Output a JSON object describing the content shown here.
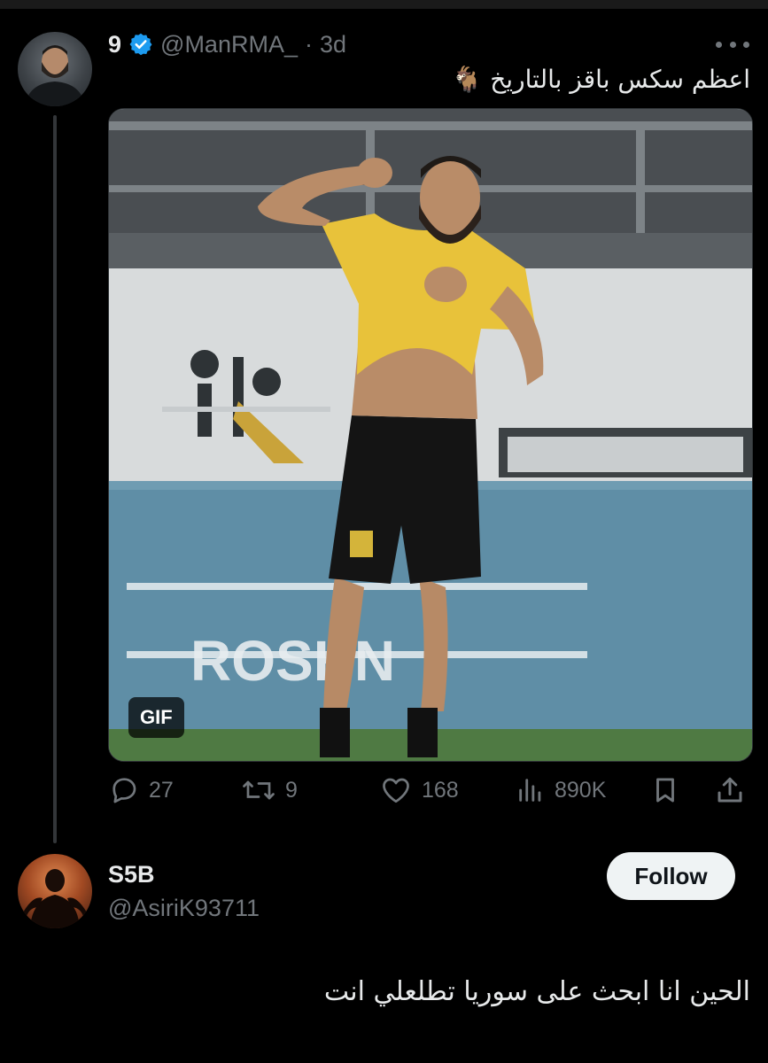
{
  "tweet": {
    "author_name": "9",
    "handle": "@ManRMA_",
    "separator": "·",
    "time": "3d",
    "text": "اعظم سكس باقز بالتاريخ 🐐",
    "media": {
      "badge": "GIF",
      "banner_text": "ROSHN"
    },
    "actions": {
      "replies": "27",
      "retweets": "9",
      "likes": "168",
      "views": "890K"
    },
    "icons": {
      "verified": "verified-badge-icon",
      "more": "more-options-icon",
      "reply": "reply-icon",
      "retweet": "retweet-icon",
      "like": "like-icon",
      "views": "views-icon",
      "bookmark": "bookmark-icon",
      "share": "share-icon"
    }
  },
  "reply": {
    "author_name": "S5B",
    "handle": "@AsiriK93711",
    "follow_label": "Follow",
    "text": "الحين انا ابحث على سوريا تطلعلي انت"
  },
  "colors": {
    "background": "#000000",
    "text": "#e7e9ea",
    "muted": "#71767b",
    "verified": "#1d9bf0",
    "follow_bg": "#eff3f4"
  }
}
